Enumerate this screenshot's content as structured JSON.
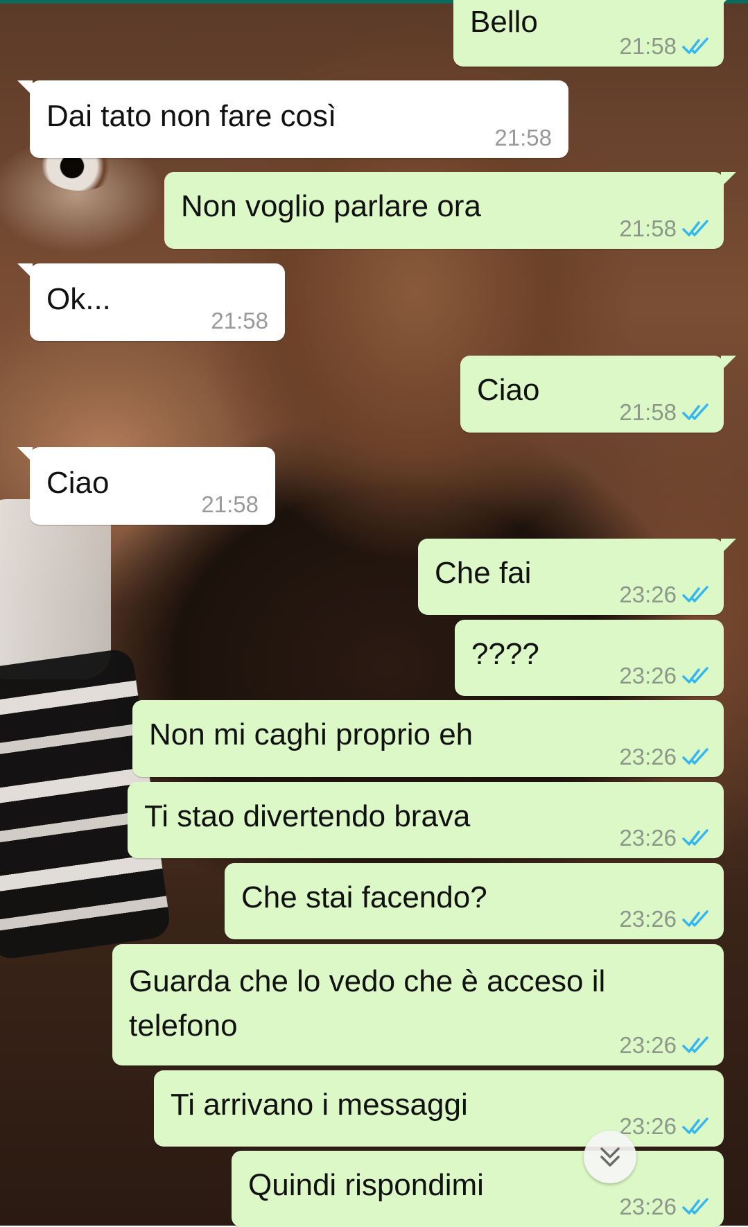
{
  "colors": {
    "outgoing_bubble": "#dcf8c6",
    "incoming_bubble": "#ffffff",
    "read_ticks": "#34b7f1",
    "timestamp": "#8c978a"
  },
  "messages": [
    {
      "dir": "out",
      "text": "Bello",
      "time": "21:58",
      "status": "read"
    },
    {
      "dir": "in",
      "text": "Dai tato non fare così",
      "time": "21:58"
    },
    {
      "dir": "out",
      "text": "Non voglio parlare ora",
      "time": "21:58",
      "status": "read"
    },
    {
      "dir": "in",
      "text": "Ok...",
      "time": "21:58"
    },
    {
      "dir": "out",
      "text": "Ciao",
      "time": "21:58",
      "status": "read"
    },
    {
      "dir": "in",
      "text": "Ciao",
      "time": "21:58"
    },
    {
      "dir": "out",
      "text": "Che fai",
      "time": "23:26",
      "status": "read"
    },
    {
      "dir": "out",
      "text": "????",
      "time": "23:26",
      "status": "read"
    },
    {
      "dir": "out",
      "text": "Non mi caghi proprio eh",
      "time": "23:26",
      "status": "read"
    },
    {
      "dir": "out",
      "text": "Ti stao divertendo brava",
      "time": "23:26",
      "status": "read"
    },
    {
      "dir": "out",
      "text": "Che stai facendo?",
      "time": "23:26",
      "status": "read"
    },
    {
      "dir": "out",
      "text": "Guarda che lo vedo che è acceso il telefono",
      "time": "23:26",
      "status": "read"
    },
    {
      "dir": "out",
      "text": "Ti arrivano i messaggi",
      "time": "23:26",
      "status": "read"
    },
    {
      "dir": "out",
      "text": "Quindi rispondimi",
      "time": "23:26",
      "status": "read"
    }
  ],
  "icons": {
    "read_receipt": "double-check-icon",
    "scroll_down": "double-chevron-down-icon"
  }
}
